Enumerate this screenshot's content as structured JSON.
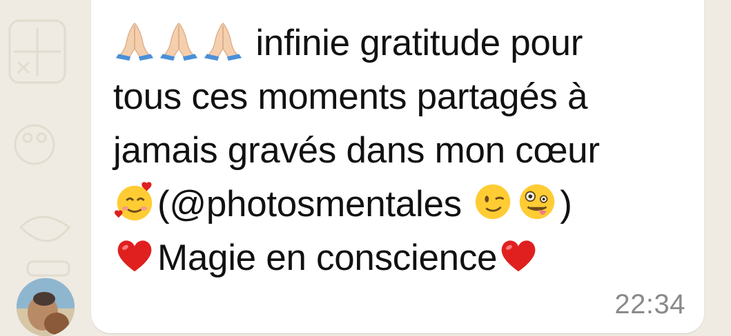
{
  "message": {
    "line1_text": " infinie gratitude pour",
    "line2_text": "tous ces moments partagés à",
    "line3_text": "jamais gravés dans mon cœur",
    "line4_text_a": "(@photosmentales ",
    "line4_text_b": ")",
    "line5_text": "Magie en conscience",
    "timestamp": "22:34"
  },
  "emojis": {
    "prayer": "folded-hands-icon",
    "smiling_hearts": "smiling-face-with-hearts-icon",
    "wink": "winking-face-icon",
    "zany": "zany-face-icon",
    "heart": "red-heart-icon"
  },
  "colors": {
    "wallpaper": "#efeae2",
    "bubble": "#ffffff",
    "text": "#111111",
    "timestamp": "#8a8a8d",
    "heart": "#e0201f"
  }
}
